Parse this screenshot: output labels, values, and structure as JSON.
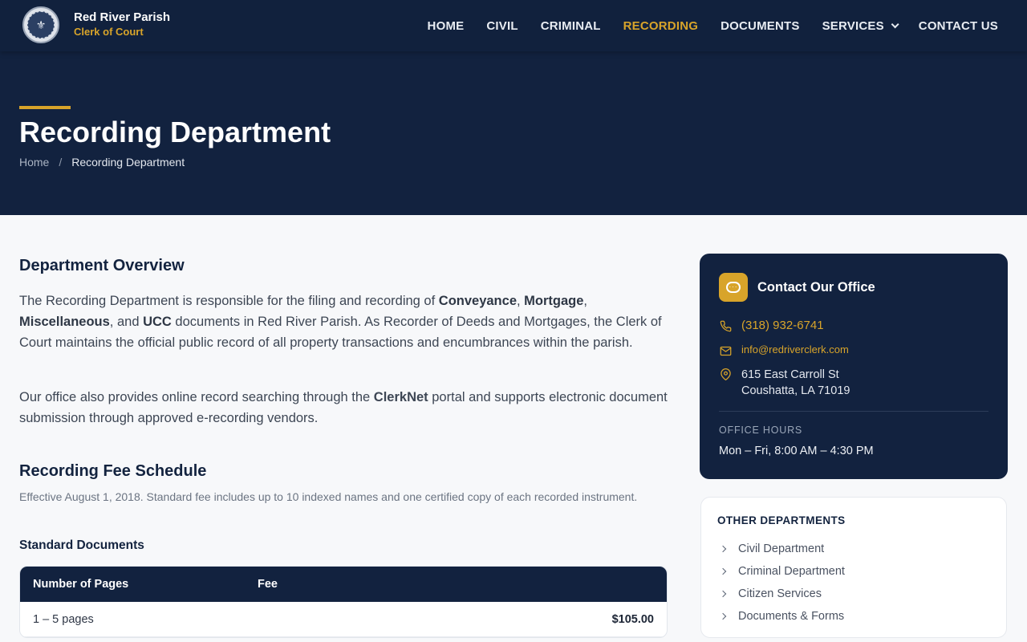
{
  "brand": {
    "name": "Red River Parish",
    "subtitle": "Clerk of Court"
  },
  "nav": {
    "items": [
      {
        "label": "HOME"
      },
      {
        "label": "CIVIL"
      },
      {
        "label": "CRIMINAL"
      },
      {
        "label": "RECORDING",
        "active": true
      },
      {
        "label": "DOCUMENTS"
      },
      {
        "label": "SERVICES",
        "has_dropdown": true
      },
      {
        "label": "CONTACT US"
      }
    ]
  },
  "hero": {
    "title": "Recording Department",
    "breadcrumb": {
      "home": "Home",
      "separator": "/",
      "current": "Recording Department"
    }
  },
  "overview": {
    "heading": "Department Overview",
    "p1": {
      "t1": "The Recording Department is responsible for the filing and recording of ",
      "b1": "Conveyance",
      "t2": ", ",
      "b2": "Mortgage",
      "t3": ", ",
      "b3": "Miscellaneous",
      "t4": ", and ",
      "b4": "UCC",
      "t5": " documents in Red River Parish. As Recorder of Deeds and Mortgages, the Clerk of Court maintains the official public record of all property transactions and encumbrances within the parish."
    },
    "p2": {
      "t1": "Our office also provides online record searching through the ",
      "b1": "ClerkNet",
      "t2": " portal and supports electronic document submission through approved e-recording vendors."
    }
  },
  "fees": {
    "heading": "Recording Fee Schedule",
    "note": "Effective August 1, 2018. Standard fee includes up to 10 indexed names and one certified copy of each recorded instrument.",
    "subheading": "Standard Documents",
    "columns": [
      "Number of Pages",
      "Fee"
    ],
    "rows": [
      {
        "pages": "1 – 5 pages",
        "fee": "$105.00"
      }
    ]
  },
  "contact": {
    "title": "Contact Our Office",
    "phone": "(318) 932-6741",
    "email": "info@redriverclerk.com",
    "address_line1": "615 East Carroll St",
    "address_line2": "Coushatta, LA 71019",
    "hours_label": "OFFICE HOURS",
    "hours": "Mon – Fri, 8:00 AM – 4:30 PM"
  },
  "other_departments": {
    "title": "OTHER DEPARTMENTS",
    "items": [
      {
        "label": "Civil Department"
      },
      {
        "label": "Criminal Department"
      },
      {
        "label": "Citizen Services"
      },
      {
        "label": "Documents & Forms"
      }
    ]
  },
  "colors": {
    "navy": "#12223f",
    "gold": "#d8a42a",
    "background": "#f7f8fa"
  }
}
